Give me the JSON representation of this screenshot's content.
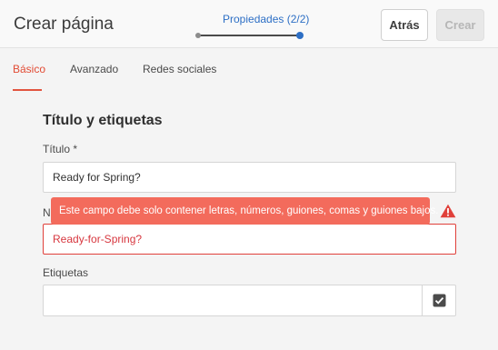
{
  "header": {
    "title": "Crear página",
    "step_label": "Propiedades (2/2)",
    "back_label": "Atrás",
    "create_label": "Crear"
  },
  "tabs": [
    {
      "label": "Básico",
      "active": true
    },
    {
      "label": "Avanzado",
      "active": false
    },
    {
      "label": "Redes sociales",
      "active": false
    }
  ],
  "form": {
    "section_title": "Título y etiquetas",
    "title_label": "Título *",
    "title_value": "Ready for Spring?",
    "name_label_partial": "N",
    "name_value": "Ready-for-Spring?",
    "error_message": "Este campo debe solo contener letras, números, guiones, comas y guiones bajos.",
    "tags_label": "Etiquetas",
    "tags_value": ""
  },
  "icons": {
    "warning": "warning-icon",
    "tag_picker": "check-square-icon"
  },
  "colors": {
    "accent": "#e24b34",
    "link_blue": "#2d6fc5",
    "error_bg": "#f36b5c",
    "error": "#e0403a"
  }
}
